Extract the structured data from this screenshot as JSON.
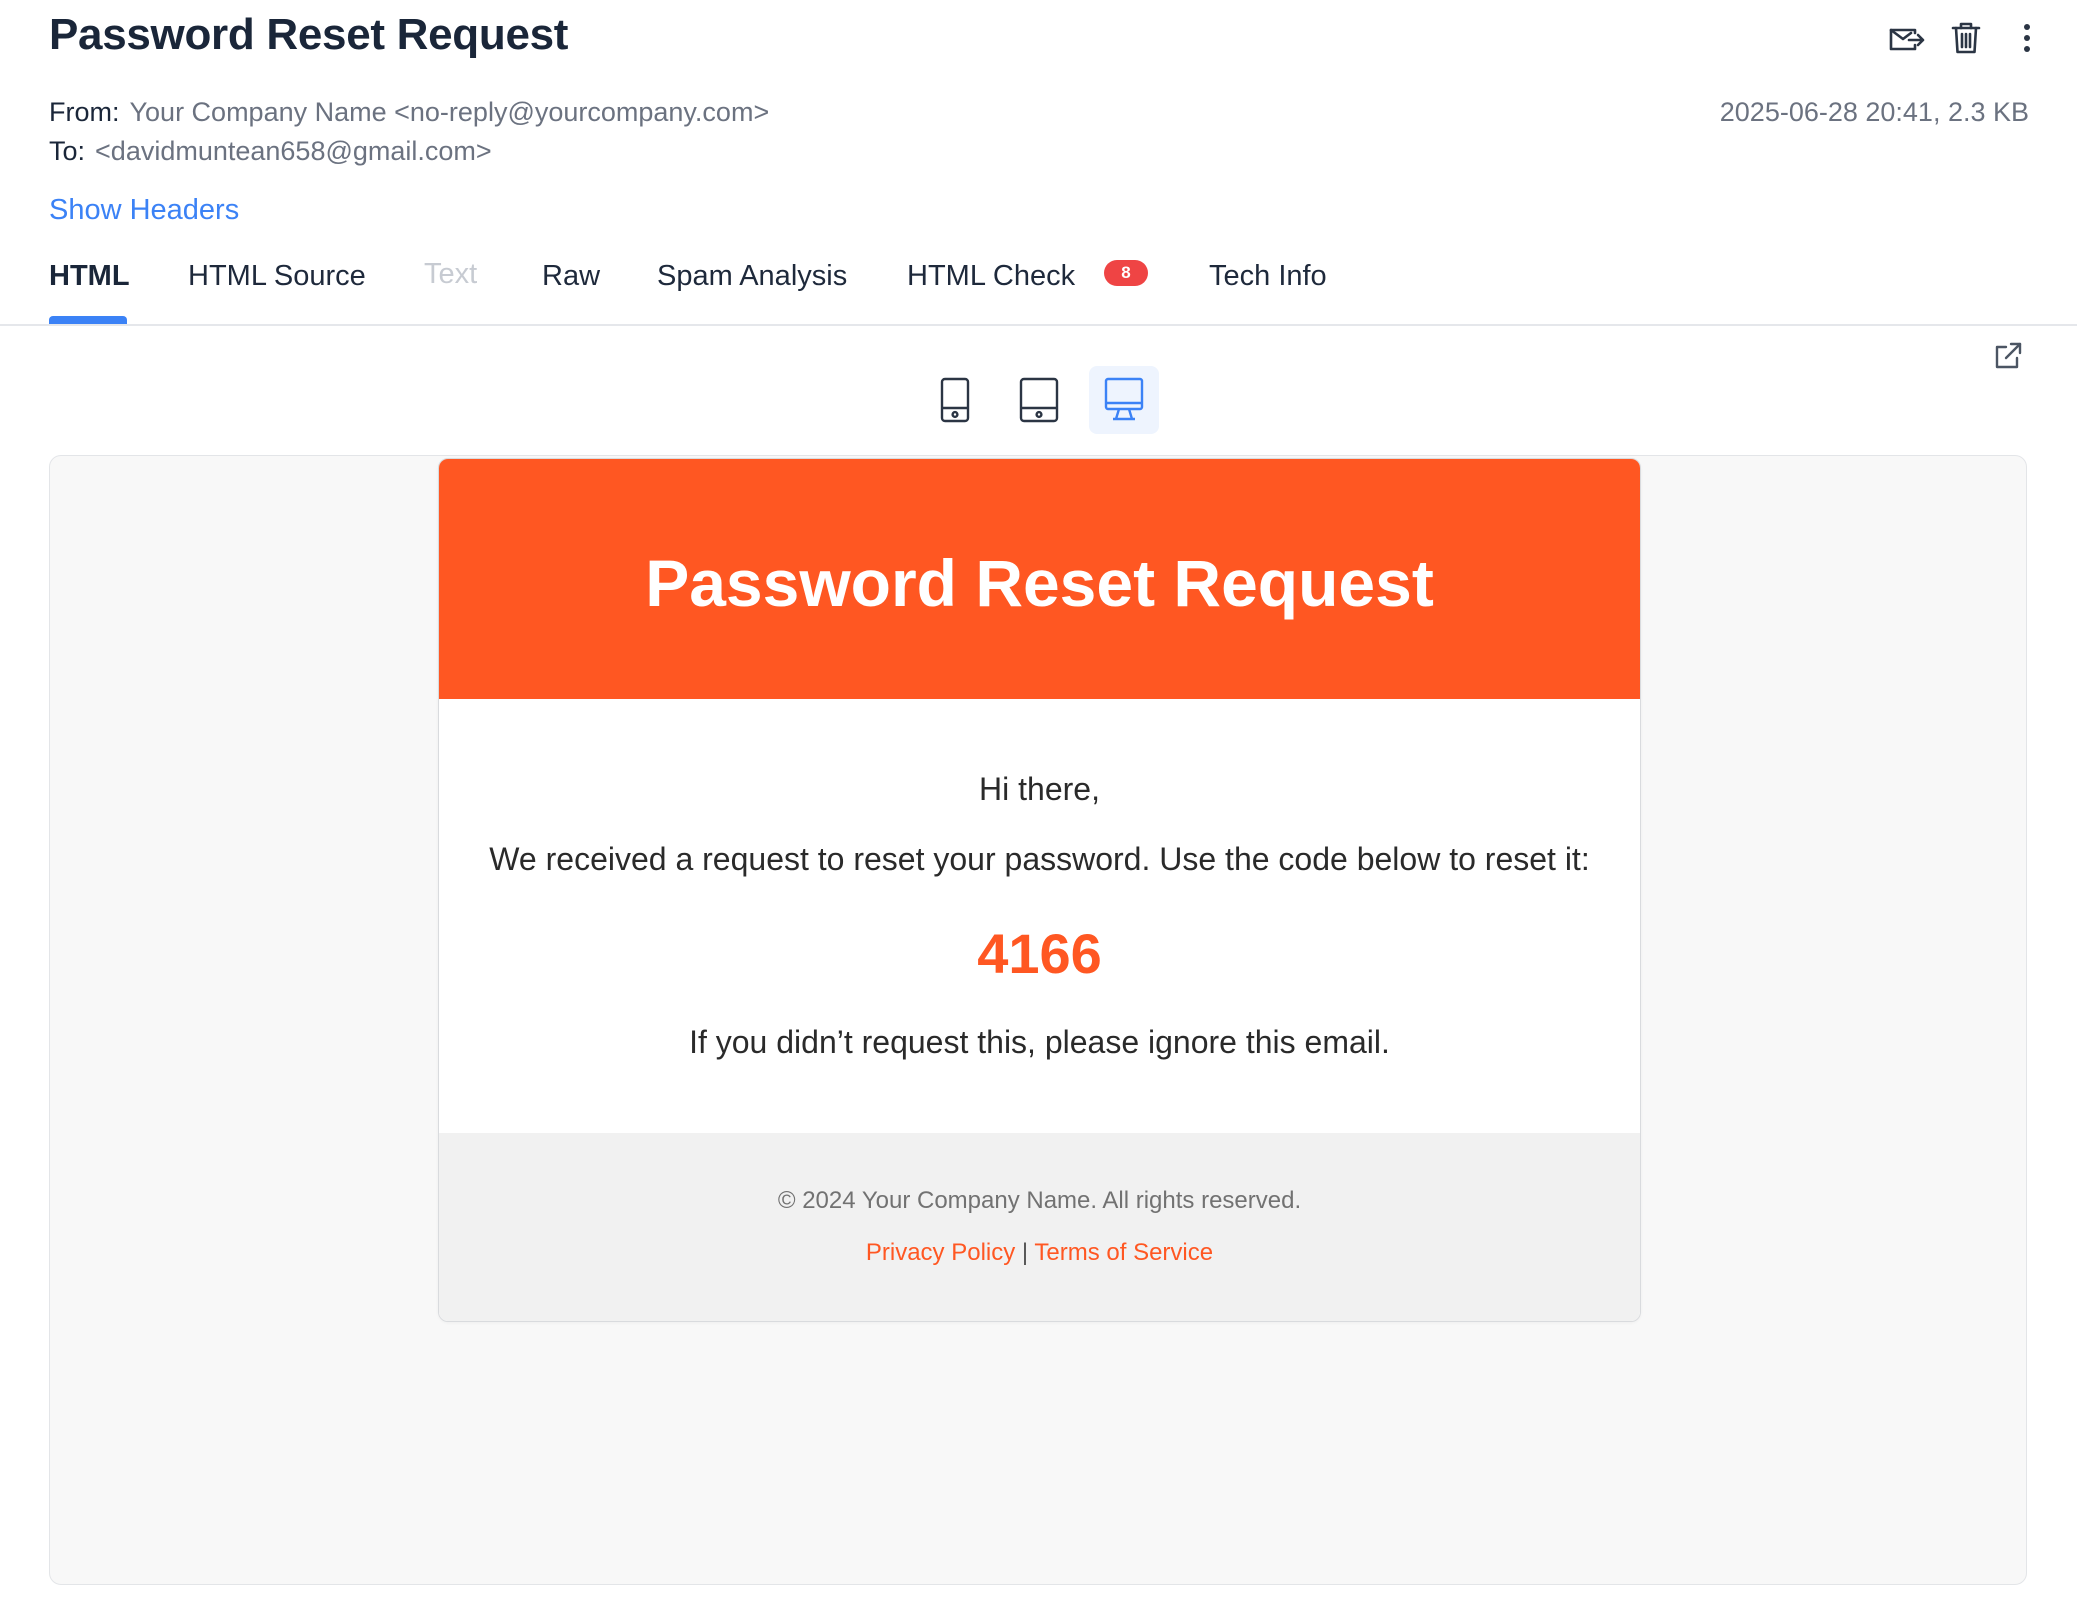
{
  "message": {
    "subject": "Password Reset Request",
    "from_label": "From:",
    "from_value": "Your Company Name <no-reply@yourcompany.com>",
    "to_label": "To:",
    "to_value": "<davidmuntean658@gmail.com>",
    "date_size": "2025-06-28 20:41, 2.3 KB",
    "show_headers": "Show Headers"
  },
  "actions": [
    {
      "icon": "forward-mail-icon"
    },
    {
      "icon": "trash-icon"
    },
    {
      "icon": "more-vertical-icon"
    }
  ],
  "tabs": [
    {
      "label": "HTML",
      "active": true
    },
    {
      "label": "HTML Source"
    },
    {
      "label": "Text",
      "disabled": true
    },
    {
      "label": "Raw"
    },
    {
      "label": "Spam Analysis"
    },
    {
      "label": "HTML Check",
      "badge": "8"
    },
    {
      "label": "Tech Info"
    }
  ],
  "device_toggle": {
    "options": [
      "mobile",
      "tablet",
      "desktop"
    ],
    "selected": "desktop"
  },
  "email": {
    "header_title": "Password Reset Request",
    "greeting": "Hi there,",
    "intro": "We received a request to reset your password. Use the code below to reset it:",
    "code": "4166",
    "ignore_note": "If you didn’t request this, please ignore this email.",
    "copyright": "© 2024 Your Company Name. All rights reserved.",
    "privacy_link": "Privacy Policy",
    "link_separator": "|",
    "terms_link": "Terms of Service"
  },
  "colors": {
    "accent": "#3b82f6",
    "brand_orange": "#ff5722",
    "badge_red": "#ef4444"
  }
}
